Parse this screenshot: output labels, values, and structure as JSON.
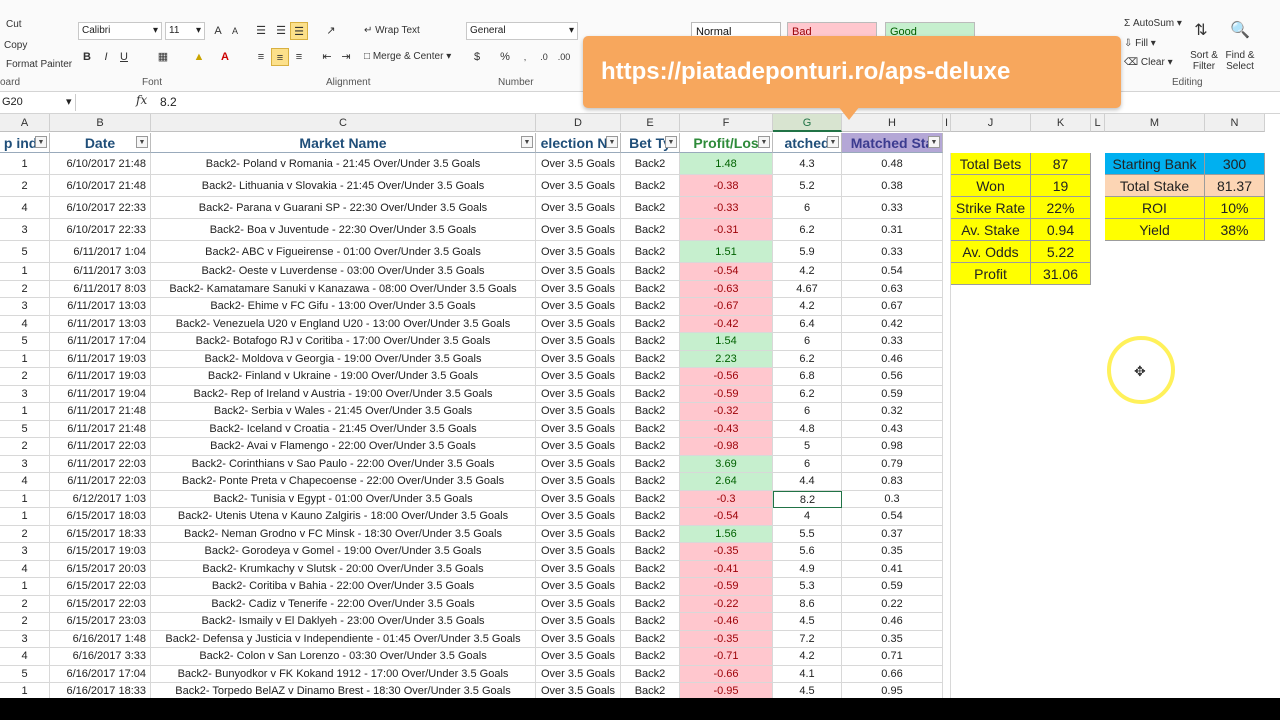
{
  "ribbon": {
    "clipboard": {
      "cut": "Cut",
      "copy": "Copy",
      "format_painter": "Format Painter",
      "group": "oard"
    },
    "font": {
      "name": "Calibri",
      "size": "11",
      "group": "Font"
    },
    "alignment": {
      "wrap": "Wrap Text",
      "merge": "Merge & Center",
      "group": "Alignment"
    },
    "number": {
      "format": "General",
      "group": "Number"
    },
    "styles": {
      "normal": "Normal",
      "bad": "Bad",
      "good": "Good"
    },
    "editing": {
      "autosum": "AutoSum",
      "fill": "Fill",
      "clear": "Clear",
      "sort": "Sort & Filter",
      "find": "Find & Select",
      "group": "Editing"
    }
  },
  "banner": "https://piatadeponturi.ro/aps-deluxe",
  "formula_bar": {
    "name_box": "G20",
    "fx": "fx",
    "value": "8.2"
  },
  "col_letters": [
    "A",
    "B",
    "C",
    "D",
    "E",
    "F",
    "G",
    "H",
    "I",
    "J",
    "K",
    "L",
    "M",
    "N"
  ],
  "headers": [
    "p inde",
    "Date",
    "Market Name",
    "election Na",
    "Bet Ty",
    "Profit/Los",
    "atched",
    "Matched Sta"
  ],
  "rows": [
    {
      "a": "1",
      "date": "6/10/2017 21:48",
      "market": "Back2- Poland v Romania - 21:45 Over/Under 3.5 Goals",
      "sel": "Over 3.5 Goals",
      "bet": "Back2",
      "pl": "1.48",
      "odds": "4.3",
      "stake": "0.48"
    },
    {
      "a": "2",
      "date": "6/10/2017 21:48",
      "market": "Back2- Lithuania v Slovakia - 21:45 Over/Under 3.5 Goals",
      "sel": "Over 3.5 Goals",
      "bet": "Back2",
      "pl": "-0.38",
      "odds": "5.2",
      "stake": "0.38"
    },
    {
      "a": "4",
      "date": "6/10/2017 22:33",
      "market": "Back2- Parana v Guarani SP - 22:30 Over/Under 3.5 Goals",
      "sel": "Over 3.5 Goals",
      "bet": "Back2",
      "pl": "-0.33",
      "odds": "6",
      "stake": "0.33"
    },
    {
      "a": "3",
      "date": "6/10/2017 22:33",
      "market": "Back2- Boa v Juventude - 22:30 Over/Under 3.5 Goals",
      "sel": "Over 3.5 Goals",
      "bet": "Back2",
      "pl": "-0.31",
      "odds": "6.2",
      "stake": "0.31"
    },
    {
      "a": "5",
      "date": "6/11/2017 1:04",
      "market": "Back2- ABC v Figueirense - 01:00 Over/Under 3.5 Goals",
      "sel": "Over 3.5 Goals",
      "bet": "Back2",
      "pl": "1.51",
      "odds": "5.9",
      "stake": "0.33"
    },
    {
      "a": "1",
      "date": "6/11/2017 3:03",
      "market": "Back2- Oeste v Luverdense - 03:00 Over/Under 3.5 Goals",
      "sel": "Over 3.5 Goals",
      "bet": "Back2",
      "pl": "-0.54",
      "odds": "4.2",
      "stake": "0.54"
    },
    {
      "a": "2",
      "date": "6/11/2017 8:03",
      "market": "Back2- Kamatamare Sanuki v Kanazawa - 08:00 Over/Under 3.5 Goals",
      "sel": "Over 3.5 Goals",
      "bet": "Back2",
      "pl": "-0.63",
      "odds": "4.67",
      "stake": "0.63"
    },
    {
      "a": "3",
      "date": "6/11/2017 13:03",
      "market": "Back2- Ehime v FC Gifu - 13:00 Over/Under 3.5 Goals",
      "sel": "Over 3.5 Goals",
      "bet": "Back2",
      "pl": "-0.67",
      "odds": "4.2",
      "stake": "0.67"
    },
    {
      "a": "4",
      "date": "6/11/2017 13:03",
      "market": "Back2- Venezuela U20 v England U20 - 13:00 Over/Under 3.5 Goals",
      "sel": "Over 3.5 Goals",
      "bet": "Back2",
      "pl": "-0.42",
      "odds": "6.4",
      "stake": "0.42"
    },
    {
      "a": "5",
      "date": "6/11/2017 17:04",
      "market": "Back2- Botafogo RJ v Coritiba - 17:00 Over/Under 3.5 Goals",
      "sel": "Over 3.5 Goals",
      "bet": "Back2",
      "pl": "1.54",
      "odds": "6",
      "stake": "0.33"
    },
    {
      "a": "1",
      "date": "6/11/2017 19:03",
      "market": "Back2- Moldova v Georgia - 19:00 Over/Under 3.5 Goals",
      "sel": "Over 3.5 Goals",
      "bet": "Back2",
      "pl": "2.23",
      "odds": "6.2",
      "stake": "0.46"
    },
    {
      "a": "2",
      "date": "6/11/2017 19:03",
      "market": "Back2- Finland v Ukraine - 19:00 Over/Under 3.5 Goals",
      "sel": "Over 3.5 Goals",
      "bet": "Back2",
      "pl": "-0.56",
      "odds": "6.8",
      "stake": "0.56"
    },
    {
      "a": "3",
      "date": "6/11/2017 19:04",
      "market": "Back2- Rep of Ireland v Austria - 19:00 Over/Under 3.5 Goals",
      "sel": "Over 3.5 Goals",
      "bet": "Back2",
      "pl": "-0.59",
      "odds": "6.2",
      "stake": "0.59"
    },
    {
      "a": "1",
      "date": "6/11/2017 21:48",
      "market": "Back2- Serbia v Wales - 21:45 Over/Under 3.5 Goals",
      "sel": "Over 3.5 Goals",
      "bet": "Back2",
      "pl": "-0.32",
      "odds": "6",
      "stake": "0.32"
    },
    {
      "a": "5",
      "date": "6/11/2017 21:48",
      "market": "Back2- Iceland v Croatia - 21:45 Over/Under 3.5 Goals",
      "sel": "Over 3.5 Goals",
      "bet": "Back2",
      "pl": "-0.43",
      "odds": "4.8",
      "stake": "0.43"
    },
    {
      "a": "2",
      "date": "6/11/2017 22:03",
      "market": "Back2- Avai v Flamengo - 22:00 Over/Under 3.5 Goals",
      "sel": "Over 3.5 Goals",
      "bet": "Back2",
      "pl": "-0.98",
      "odds": "5",
      "stake": "0.98"
    },
    {
      "a": "3",
      "date": "6/11/2017 22:03",
      "market": "Back2- Corinthians v Sao Paulo - 22:00 Over/Under 3.5 Goals",
      "sel": "Over 3.5 Goals",
      "bet": "Back2",
      "pl": "3.69",
      "odds": "6",
      "stake": "0.79"
    },
    {
      "a": "4",
      "date": "6/11/2017 22:03",
      "market": "Back2- Ponte Preta v Chapecoense - 22:00 Over/Under 3.5 Goals",
      "sel": "Over 3.5 Goals",
      "bet": "Back2",
      "pl": "2.64",
      "odds": "4.4",
      "stake": "0.83"
    },
    {
      "a": "1",
      "date": "6/12/2017 1:03",
      "market": "Back2- Tunisia v Egypt - 01:00 Over/Under 3.5 Goals",
      "sel": "Over 3.5 Goals",
      "bet": "Back2",
      "pl": "-0.3",
      "odds": "8.2",
      "stake": "0.3"
    },
    {
      "a": "1",
      "date": "6/15/2017 18:03",
      "market": "Back2- Utenis Utena v Kauno Zalgiris - 18:00 Over/Under 3.5 Goals",
      "sel": "Over 3.5 Goals",
      "bet": "Back2",
      "pl": "-0.54",
      "odds": "4",
      "stake": "0.54"
    },
    {
      "a": "2",
      "date": "6/15/2017 18:33",
      "market": "Back2- Neman Grodno v FC Minsk - 18:30 Over/Under 3.5 Goals",
      "sel": "Over 3.5 Goals",
      "bet": "Back2",
      "pl": "1.56",
      "odds": "5.5",
      "stake": "0.37"
    },
    {
      "a": "3",
      "date": "6/15/2017 19:03",
      "market": "Back2- Gorodeya v Gomel - 19:00 Over/Under 3.5 Goals",
      "sel": "Over 3.5 Goals",
      "bet": "Back2",
      "pl": "-0.35",
      "odds": "5.6",
      "stake": "0.35"
    },
    {
      "a": "4",
      "date": "6/15/2017 20:03",
      "market": "Back2- Krumkachy v Slutsk - 20:00 Over/Under 3.5 Goals",
      "sel": "Over 3.5 Goals",
      "bet": "Back2",
      "pl": "-0.41",
      "odds": "4.9",
      "stake": "0.41"
    },
    {
      "a": "1",
      "date": "6/15/2017 22:03",
      "market": "Back2- Coritiba v Bahia - 22:00 Over/Under 3.5 Goals",
      "sel": "Over 3.5 Goals",
      "bet": "Back2",
      "pl": "-0.59",
      "odds": "5.3",
      "stake": "0.59"
    },
    {
      "a": "2",
      "date": "6/15/2017 22:03",
      "market": "Back2- Cadiz v Tenerife - 22:00 Over/Under 3.5 Goals",
      "sel": "Over 3.5 Goals",
      "bet": "Back2",
      "pl": "-0.22",
      "odds": "8.6",
      "stake": "0.22"
    },
    {
      "a": "2",
      "date": "6/15/2017 23:03",
      "market": "Back2- Ismaily v El Daklyeh - 23:00 Over/Under 3.5 Goals",
      "sel": "Over 3.5 Goals",
      "bet": "Back2",
      "pl": "-0.46",
      "odds": "4.5",
      "stake": "0.46"
    },
    {
      "a": "3",
      "date": "6/16/2017 1:48",
      "market": "Back2- Defensa y Justicia v Independiente - 01:45 Over/Under 3.5 Goals",
      "sel": "Over 3.5 Goals",
      "bet": "Back2",
      "pl": "-0.35",
      "odds": "7.2",
      "stake": "0.35"
    },
    {
      "a": "4",
      "date": "6/16/2017 3:33",
      "market": "Back2- Colon v San Lorenzo - 03:30 Over/Under 3.5 Goals",
      "sel": "Over 3.5 Goals",
      "bet": "Back2",
      "pl": "-0.71",
      "odds": "4.2",
      "stake": "0.71"
    },
    {
      "a": "5",
      "date": "6/16/2017 17:04",
      "market": "Back2- Bunyodkor v FK Kokand 1912 - 17:00 Over/Under 3.5 Goals",
      "sel": "Over 3.5 Goals",
      "bet": "Back2",
      "pl": "-0.66",
      "odds": "4.1",
      "stake": "0.66"
    },
    {
      "a": "1",
      "date": "6/16/2017 18:33",
      "market": "Back2- Torpedo BelAZ v Dinamo Brest - 18:30 Over/Under 3.5 Goals",
      "sel": "Over 3.5 Goals",
      "bet": "Back2",
      "pl": "-0.95",
      "odds": "4.5",
      "stake": "0.95"
    }
  ],
  "stats": [
    {
      "label": "Total Bets",
      "value": "87"
    },
    {
      "label": "Won",
      "value": "19"
    },
    {
      "label": "Strike Rate",
      "value": "22%"
    },
    {
      "label": "Av. Stake",
      "value": "0.94"
    },
    {
      "label": "Av. Odds",
      "value": "5.22"
    },
    {
      "label": "Profit",
      "value": "31.06"
    }
  ],
  "bank": [
    {
      "label": "Starting Bank",
      "value": "300"
    },
    {
      "label": "Total Stake",
      "value": "81.37"
    },
    {
      "label": "ROI",
      "value": "10%"
    },
    {
      "label": "Yield",
      "value": "38%"
    }
  ]
}
